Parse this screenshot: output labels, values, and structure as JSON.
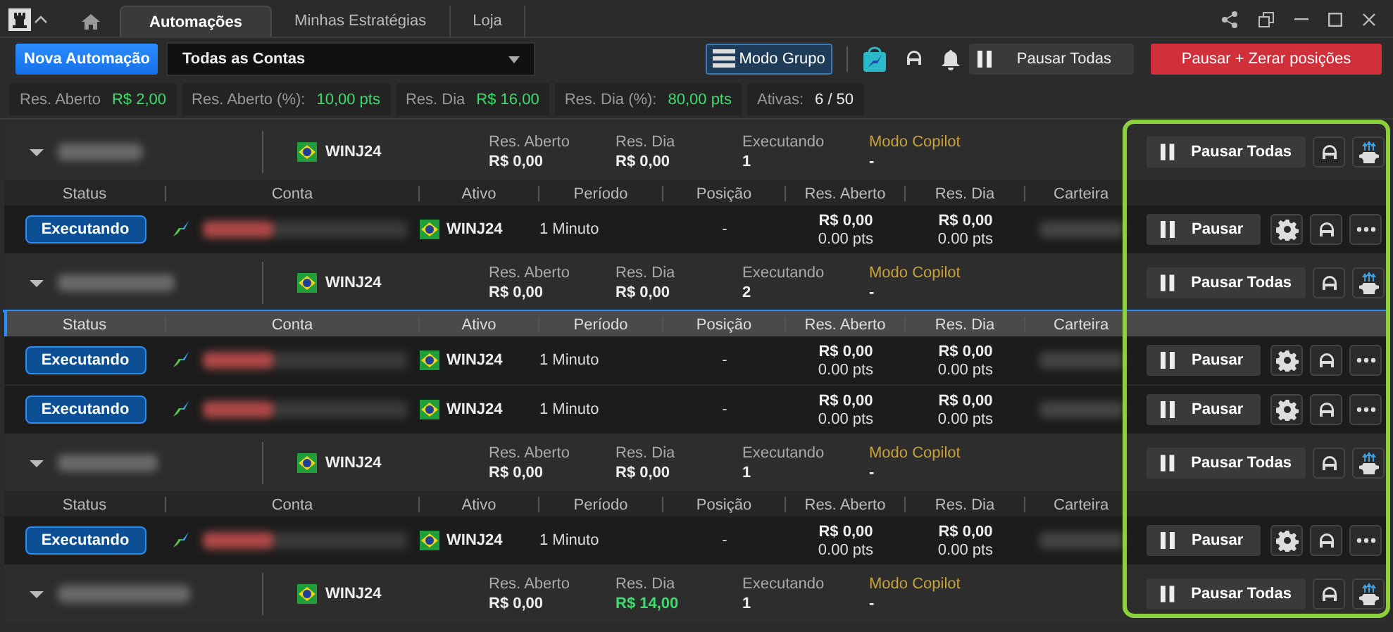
{
  "tabs": [
    {
      "label": "Automações",
      "selected": true
    },
    {
      "label": "Minhas Estratégias",
      "selected": false
    },
    {
      "label": "Loja",
      "selected": false
    }
  ],
  "toolbar": {
    "new_button": "Nova Automação",
    "account_select": "Todas as Contas",
    "group_mode_button": "Modo Grupo",
    "group_mode_on": true,
    "pause_all_button": "Pausar Todas",
    "pause_reset_button": "Pausar + Zerar posições"
  },
  "summary": [
    {
      "label": "Res. Aberto",
      "value": "R$ 2,00",
      "positive": true
    },
    {
      "label": "Res. Aberto (%):",
      "value": "10,00 pts",
      "positive": true
    },
    {
      "label": "Res. Dia",
      "value": "R$ 16,00",
      "positive": true
    },
    {
      "label": "Res. Dia (%):",
      "value": "80,00 pts",
      "positive": true
    },
    {
      "label": "Ativas:",
      "value": "6 / 50",
      "positive": false
    }
  ],
  "groups": [
    {
      "ativo": "WINJ24",
      "expanded": true,
      "res_aberto": {
        "label": "Res. Aberto",
        "value": "R$ 0,00",
        "positive": false
      },
      "res_dia": {
        "label": "Res. Dia",
        "value": "R$ 0,00",
        "positive": false
      },
      "executando": {
        "label": "Executando",
        "value": "1"
      },
      "modo": {
        "label": "Modo Copilot",
        "value": "-"
      },
      "pause_button": "Pausar Todas",
      "header_highlighted": false,
      "columns": [
        "Status",
        "Conta",
        "Ativo",
        "Período",
        "Posição",
        "Res. Aberto",
        "Res. Dia",
        "Carteira"
      ],
      "rows": [
        {
          "status": "Executando",
          "ativo": "WINJ24",
          "periodo": "1 Minuto",
          "posicao": "-",
          "res_aberto": "R$ 0,00",
          "res_aberto_pts": "0.00 pts",
          "res_dia": "R$ 0,00",
          "res_dia_pts": "0.00 pts",
          "pause_button": "Pausar"
        }
      ]
    },
    {
      "ativo": "WINJ24",
      "expanded": true,
      "res_aberto": {
        "label": "Res. Aberto",
        "value": "R$ 0,00",
        "positive": false
      },
      "res_dia": {
        "label": "Res. Dia",
        "value": "R$ 0,00",
        "positive": false
      },
      "executando": {
        "label": "Executando",
        "value": "2"
      },
      "modo": {
        "label": "Modo Copilot",
        "value": "-"
      },
      "pause_button": "Pausar Todas",
      "header_highlighted": true,
      "columns": [
        "Status",
        "Conta",
        "Ativo",
        "Período",
        "Posição",
        "Res. Aberto",
        "Res. Dia",
        "Carteira"
      ],
      "rows": [
        {
          "status": "Executando",
          "ativo": "WINJ24",
          "periodo": "1 Minuto",
          "posicao": "-",
          "res_aberto": "R$ 0,00",
          "res_aberto_pts": "0.00 pts",
          "res_dia": "R$ 0,00",
          "res_dia_pts": "0.00 pts",
          "pause_button": "Pausar"
        },
        {
          "status": "Executando",
          "ativo": "WINJ24",
          "periodo": "1 Minuto",
          "posicao": "-",
          "res_aberto": "R$ 0,00",
          "res_aberto_pts": "0.00 pts",
          "res_dia": "R$ 0,00",
          "res_dia_pts": "0.00 pts",
          "pause_button": "Pausar"
        }
      ]
    },
    {
      "ativo": "WINJ24",
      "expanded": true,
      "res_aberto": {
        "label": "Res. Aberto",
        "value": "R$ 0,00",
        "positive": false
      },
      "res_dia": {
        "label": "Res. Dia",
        "value": "R$ 0,00",
        "positive": false
      },
      "executando": {
        "label": "Executando",
        "value": "1"
      },
      "modo": {
        "label": "Modo Copilot",
        "value": "-"
      },
      "pause_button": "Pausar Todas",
      "header_highlighted": false,
      "columns": [
        "Status",
        "Conta",
        "Ativo",
        "Período",
        "Posição",
        "Res. Aberto",
        "Res. Dia",
        "Carteira"
      ],
      "rows": [
        {
          "status": "Executando",
          "ativo": "WINJ24",
          "periodo": "1 Minuto",
          "posicao": "-",
          "res_aberto": "R$ 0,00",
          "res_aberto_pts": "0.00 pts",
          "res_dia": "R$ 0,00",
          "res_dia_pts": "0.00 pts",
          "pause_button": "Pausar"
        }
      ]
    },
    {
      "ativo": "WINJ24",
      "expanded": true,
      "res_aberto": {
        "label": "Res. Aberto",
        "value": "R$ 0,00",
        "positive": false
      },
      "res_dia": {
        "label": "Res. Dia",
        "value": "R$ 14,00",
        "positive": true
      },
      "executando": {
        "label": "Executando",
        "value": "1"
      },
      "modo": {
        "label": "Modo Copilot",
        "value": "-"
      },
      "pause_button": "Pausar Todas",
      "header_highlighted": false
    }
  ]
}
